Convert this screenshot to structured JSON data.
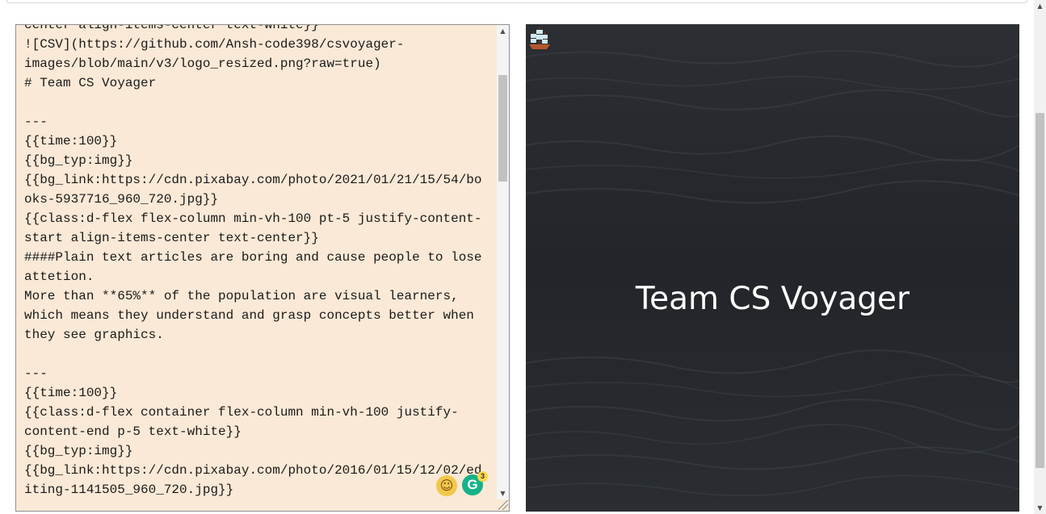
{
  "editor": {
    "content": "center align-items-center text-white}}\n![CSV](https://github.com/Ansh-code398/csvoyager-\nimages/blob/main/v3/logo_resized.png?raw=true)\n# Team CS Voyager\n\n---\n{{time:100}}\n{{bg_typ:img}}\n{{bg_link:https://cdn.pixabay.com/photo/2021/01/21/15/54/bo\noks-5937716_960_720.jpg}}\n{{class:d-flex flex-column min-vh-100 pt-5 justify-content-\nstart align-items-center text-center}}\n####Plain text articles are boring and cause people to lose\nattetion.\nMore than **65%** of the population are visual learners,\nwhich means they understand and grasp concepts better when\nthey see graphics.\n\n---\n{{time:100}}\n{{class:d-flex container flex-column min-vh-100 justify-\ncontent-end p-5 text-white}}\n{{bg_typ:img}}\n{{bg_link:https://cdn.pixabay.com/photo/2016/01/15/12/02/ed\niting-1141505_960_720.jpg}}",
    "emoji_icon": "emoji-button-icon",
    "grammarly_badge": "3",
    "grammarly_letter": "G"
  },
  "preview": {
    "title": "Team CS Voyager",
    "logo_icon": "ship-logo-icon",
    "background": "#26292d"
  },
  "colors": {
    "editor_bg": "#fae9d6",
    "grammarly": "#15b289"
  }
}
